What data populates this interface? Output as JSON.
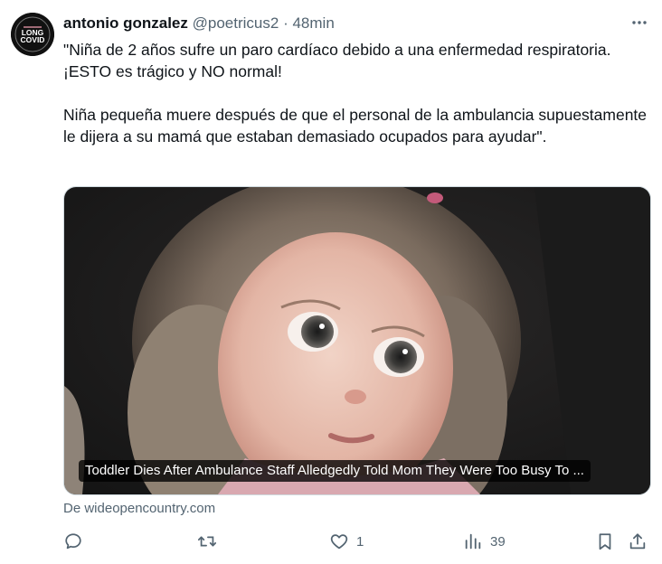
{
  "tweet": {
    "author_name": "antonio gonzalez",
    "handle": "@poetricus2",
    "separator": "·",
    "time": "48min",
    "text": "\"Niña de 2 años sufre un paro cardíaco debido a una enfermedad respiratoria. ¡ESTO es trágico y NO normal!\n\nNiña pequeña muere después de que el personal de la ambulancia supuestamente le dijera a su mamá que estaban demasiado ocupados para ayudar\".",
    "avatar": {
      "line1": "LONG",
      "line2": "COVID"
    },
    "link_card": {
      "title": "Toddler Dies After Ambulance Staff Alledgedly Told Mom They Were Too Busy To ...",
      "source": "De wideopencountry.com"
    },
    "actions": {
      "reply_icon": "reply-icon",
      "retweet_icon": "retweet-icon",
      "like_icon": "heart-icon",
      "like_count": "1",
      "views_icon": "views-icon",
      "views_count": "39",
      "bookmark_icon": "bookmark-icon",
      "share_icon": "share-icon"
    }
  }
}
